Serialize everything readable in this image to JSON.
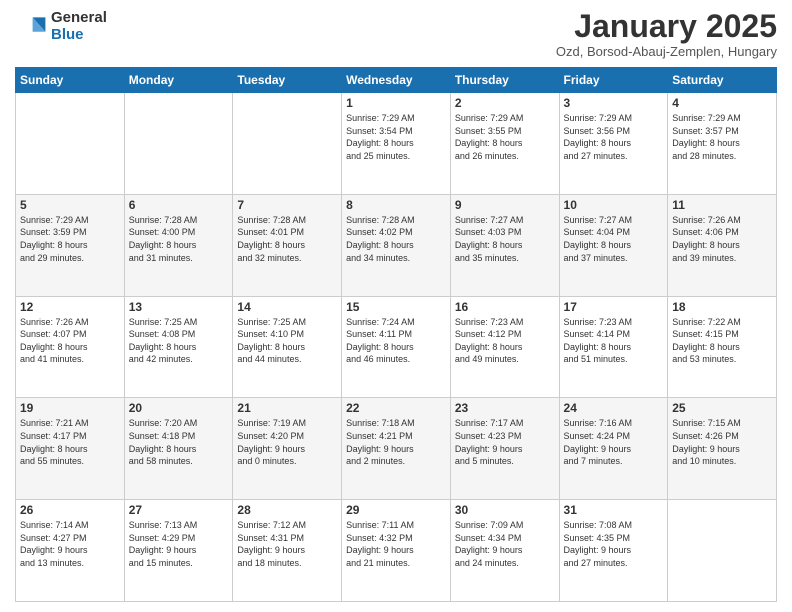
{
  "logo": {
    "general": "General",
    "blue": "Blue"
  },
  "header": {
    "month": "January 2025",
    "location": "Ozd, Borsod-Abauj-Zemplen, Hungary"
  },
  "days_of_week": [
    "Sunday",
    "Monday",
    "Tuesday",
    "Wednesday",
    "Thursday",
    "Friday",
    "Saturday"
  ],
  "weeks": [
    [
      {
        "day": "",
        "info": ""
      },
      {
        "day": "",
        "info": ""
      },
      {
        "day": "",
        "info": ""
      },
      {
        "day": "1",
        "info": "Sunrise: 7:29 AM\nSunset: 3:54 PM\nDaylight: 8 hours\nand 25 minutes."
      },
      {
        "day": "2",
        "info": "Sunrise: 7:29 AM\nSunset: 3:55 PM\nDaylight: 8 hours\nand 26 minutes."
      },
      {
        "day": "3",
        "info": "Sunrise: 7:29 AM\nSunset: 3:56 PM\nDaylight: 8 hours\nand 27 minutes."
      },
      {
        "day": "4",
        "info": "Sunrise: 7:29 AM\nSunset: 3:57 PM\nDaylight: 8 hours\nand 28 minutes."
      }
    ],
    [
      {
        "day": "5",
        "info": "Sunrise: 7:29 AM\nSunset: 3:59 PM\nDaylight: 8 hours\nand 29 minutes."
      },
      {
        "day": "6",
        "info": "Sunrise: 7:28 AM\nSunset: 4:00 PM\nDaylight: 8 hours\nand 31 minutes."
      },
      {
        "day": "7",
        "info": "Sunrise: 7:28 AM\nSunset: 4:01 PM\nDaylight: 8 hours\nand 32 minutes."
      },
      {
        "day": "8",
        "info": "Sunrise: 7:28 AM\nSunset: 4:02 PM\nDaylight: 8 hours\nand 34 minutes."
      },
      {
        "day": "9",
        "info": "Sunrise: 7:27 AM\nSunset: 4:03 PM\nDaylight: 8 hours\nand 35 minutes."
      },
      {
        "day": "10",
        "info": "Sunrise: 7:27 AM\nSunset: 4:04 PM\nDaylight: 8 hours\nand 37 minutes."
      },
      {
        "day": "11",
        "info": "Sunrise: 7:26 AM\nSunset: 4:06 PM\nDaylight: 8 hours\nand 39 minutes."
      }
    ],
    [
      {
        "day": "12",
        "info": "Sunrise: 7:26 AM\nSunset: 4:07 PM\nDaylight: 8 hours\nand 41 minutes."
      },
      {
        "day": "13",
        "info": "Sunrise: 7:25 AM\nSunset: 4:08 PM\nDaylight: 8 hours\nand 42 minutes."
      },
      {
        "day": "14",
        "info": "Sunrise: 7:25 AM\nSunset: 4:10 PM\nDaylight: 8 hours\nand 44 minutes."
      },
      {
        "day": "15",
        "info": "Sunrise: 7:24 AM\nSunset: 4:11 PM\nDaylight: 8 hours\nand 46 minutes."
      },
      {
        "day": "16",
        "info": "Sunrise: 7:23 AM\nSunset: 4:12 PM\nDaylight: 8 hours\nand 49 minutes."
      },
      {
        "day": "17",
        "info": "Sunrise: 7:23 AM\nSunset: 4:14 PM\nDaylight: 8 hours\nand 51 minutes."
      },
      {
        "day": "18",
        "info": "Sunrise: 7:22 AM\nSunset: 4:15 PM\nDaylight: 8 hours\nand 53 minutes."
      }
    ],
    [
      {
        "day": "19",
        "info": "Sunrise: 7:21 AM\nSunset: 4:17 PM\nDaylight: 8 hours\nand 55 minutes."
      },
      {
        "day": "20",
        "info": "Sunrise: 7:20 AM\nSunset: 4:18 PM\nDaylight: 8 hours\nand 58 minutes."
      },
      {
        "day": "21",
        "info": "Sunrise: 7:19 AM\nSunset: 4:20 PM\nDaylight: 9 hours\nand 0 minutes."
      },
      {
        "day": "22",
        "info": "Sunrise: 7:18 AM\nSunset: 4:21 PM\nDaylight: 9 hours\nand 2 minutes."
      },
      {
        "day": "23",
        "info": "Sunrise: 7:17 AM\nSunset: 4:23 PM\nDaylight: 9 hours\nand 5 minutes."
      },
      {
        "day": "24",
        "info": "Sunrise: 7:16 AM\nSunset: 4:24 PM\nDaylight: 9 hours\nand 7 minutes."
      },
      {
        "day": "25",
        "info": "Sunrise: 7:15 AM\nSunset: 4:26 PM\nDaylight: 9 hours\nand 10 minutes."
      }
    ],
    [
      {
        "day": "26",
        "info": "Sunrise: 7:14 AM\nSunset: 4:27 PM\nDaylight: 9 hours\nand 13 minutes."
      },
      {
        "day": "27",
        "info": "Sunrise: 7:13 AM\nSunset: 4:29 PM\nDaylight: 9 hours\nand 15 minutes."
      },
      {
        "day": "28",
        "info": "Sunrise: 7:12 AM\nSunset: 4:31 PM\nDaylight: 9 hours\nand 18 minutes."
      },
      {
        "day": "29",
        "info": "Sunrise: 7:11 AM\nSunset: 4:32 PM\nDaylight: 9 hours\nand 21 minutes."
      },
      {
        "day": "30",
        "info": "Sunrise: 7:09 AM\nSunset: 4:34 PM\nDaylight: 9 hours\nand 24 minutes."
      },
      {
        "day": "31",
        "info": "Sunrise: 7:08 AM\nSunset: 4:35 PM\nDaylight: 9 hours\nand 27 minutes."
      },
      {
        "day": "",
        "info": ""
      }
    ]
  ]
}
